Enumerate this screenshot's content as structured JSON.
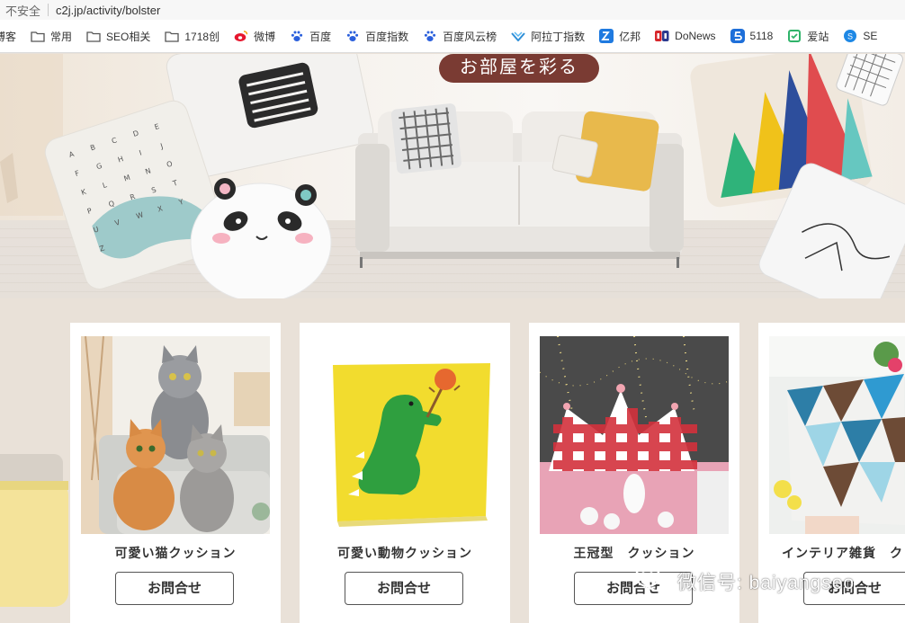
{
  "browser": {
    "insecure_label": "不安全",
    "url": "c2j.jp/activity/bolster"
  },
  "bookmarks": [
    {
      "label": "博客",
      "icon": "folder-icon"
    },
    {
      "label": "常用",
      "icon": "folder-icon"
    },
    {
      "label": "SEO相关",
      "icon": "folder-icon"
    },
    {
      "label": "1718创",
      "icon": "folder-icon"
    },
    {
      "label": "微博",
      "icon": "weibo-icon"
    },
    {
      "label": "百度",
      "icon": "baidu-paw-icon"
    },
    {
      "label": "百度指数",
      "icon": "baidu-paw-icon"
    },
    {
      "label": "百度风云榜",
      "icon": "baidu-paw-icon"
    },
    {
      "label": "阿拉丁指数",
      "icon": "aladdin-icon"
    },
    {
      "label": "亿邦",
      "icon": "yibang-icon"
    },
    {
      "label": "DoNews",
      "icon": "donews-icon"
    },
    {
      "label": "5118",
      "icon": "5118-icon"
    },
    {
      "label": "爱站",
      "icon": "aizhan-icon"
    },
    {
      "label": "SE",
      "icon": "se-icon"
    }
  ],
  "banner": {
    "title": "お部屋を彩る",
    "letters": [
      "A",
      "B",
      "C",
      "D",
      "E",
      "F",
      "G",
      "H",
      "I",
      "J",
      "K",
      "L",
      "M",
      "N",
      "O",
      "P",
      "Q",
      "R",
      "S",
      "T",
      "U",
      "V",
      "W",
      "X",
      "Y",
      "Z"
    ]
  },
  "products": [
    {
      "name": "可愛い猫クッション",
      "button": "お問合せ"
    },
    {
      "name": "可愛い動物クッション",
      "button": "お問合せ"
    },
    {
      "name": "王冠型　クッション",
      "button": "お問合せ"
    },
    {
      "name": "インテリア雑貨　クッ",
      "button": "お問合せ"
    }
  ],
  "watermark": {
    "text": "微信号: baiyangseo"
  },
  "colors": {
    "page_bg": "#e9e1d8",
    "banner_title_bg": "#7a3b33",
    "card_bg": "#ffffff"
  }
}
